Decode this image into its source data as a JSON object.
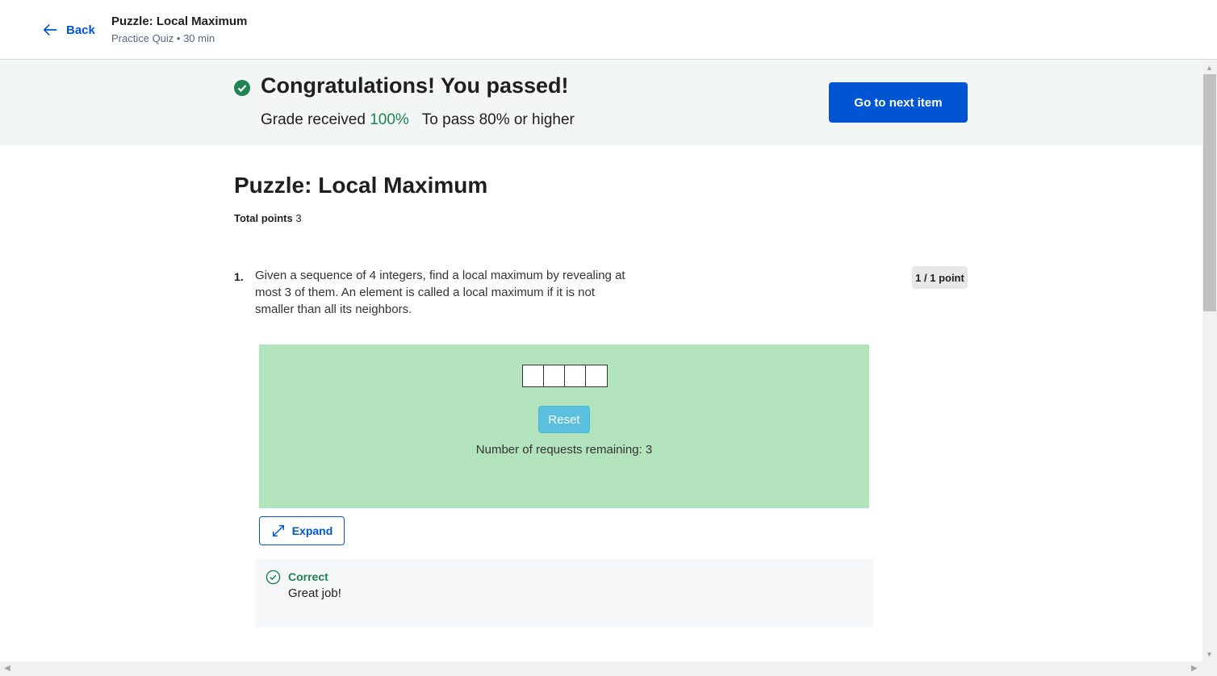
{
  "header": {
    "back_label": "Back",
    "title": "Puzzle: Local Maximum",
    "subtitle": "Practice Quiz • 30 min"
  },
  "banner": {
    "message": "Congratulations! You passed!",
    "grade_label": "Grade received",
    "grade_value": "100%",
    "pass_label": "To pass",
    "pass_value": "80% or higher",
    "next_button": "Go to next item"
  },
  "quiz": {
    "title": "Puzzle: Local Maximum",
    "total_points_label": "Total points",
    "total_points_value": "3"
  },
  "question": {
    "number": "1.",
    "text": "Given a sequence of 4 integers, find a local maximum by revealing at most 3 of them. An element is called a local maximum if it is not smaller than all its neighbors.",
    "points_badge": "1 / 1 point",
    "puzzle": {
      "cells": [
        "",
        "",
        "",
        ""
      ],
      "reset_label": "Reset",
      "remaining_text": "Number of requests remaining: 3"
    },
    "expand_label": "Expand",
    "feedback": {
      "status": "Correct",
      "message": "Great job!"
    }
  },
  "colors": {
    "accent": "#0056d2",
    "success": "#1f8354",
    "puzzle_bg": "#b2e3bc",
    "reset_bg": "#5bc0de"
  }
}
